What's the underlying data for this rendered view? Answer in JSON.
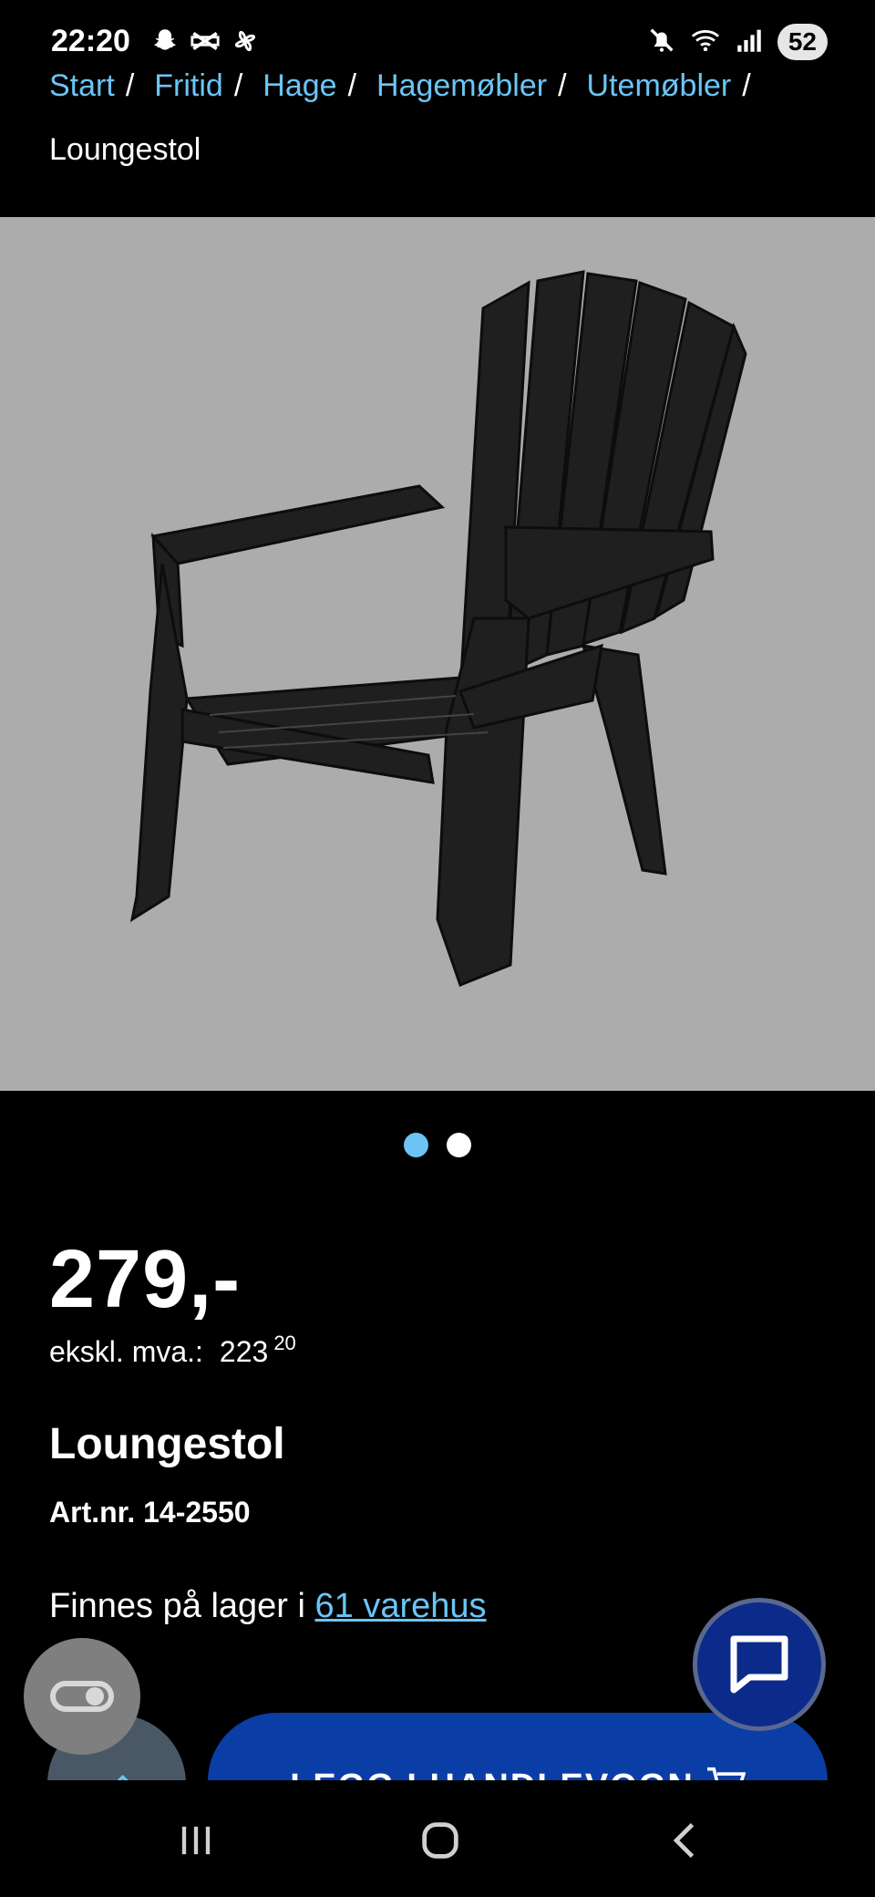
{
  "status_bar": {
    "time": "22:20",
    "left_icons": [
      "snapchat-icon",
      "capcut-icon",
      "pinwheel-icon"
    ],
    "right_icons": [
      "mute-icon",
      "wifi-icon",
      "signal-icon"
    ],
    "battery": "52"
  },
  "breadcrumb": {
    "items": [
      {
        "label": "Start",
        "sep": "/"
      },
      {
        "label": "Fritid",
        "sep": "/"
      },
      {
        "label": "Hage",
        "sep": "/"
      },
      {
        "label": "Hagemøbler",
        "sep": "/"
      },
      {
        "label": "Utemøbler",
        "sep": "/"
      }
    ],
    "current": "Loungestol"
  },
  "gallery": {
    "image_subject": "black plastic lounge chair",
    "dots": 2,
    "active_dot": 1
  },
  "product": {
    "price": "279,-",
    "ex_vat_label": "ekskl. mva.:",
    "ex_vat_int": "223",
    "ex_vat_dec": "20",
    "title": "Loungestol",
    "art_nr": "Art.nr. 14-2550",
    "stock_prefix": "Finnes på lager i ",
    "stock_link": "61 varehus"
  },
  "actions": {
    "cart_label": "LEGG I HANDLEVOGN"
  },
  "colors": {
    "background": "#000000",
    "link": "#6cc4f5",
    "primary_button": "#0b3da6",
    "image_bg": "#acacac",
    "chat_button": "#0b2a8a"
  }
}
